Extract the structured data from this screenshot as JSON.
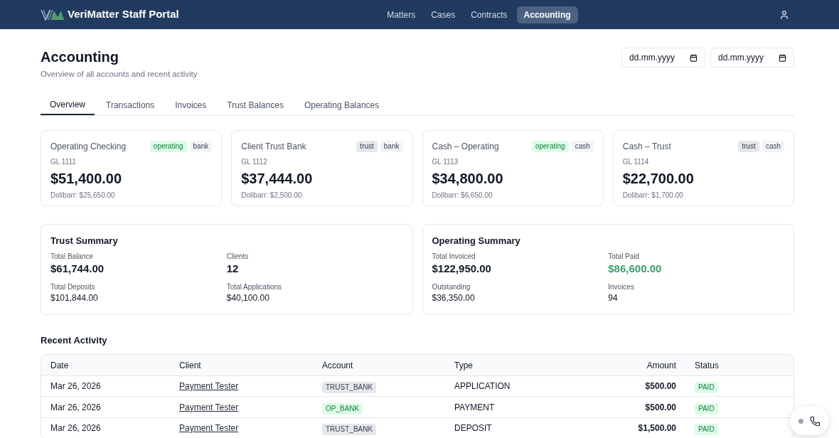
{
  "header": {
    "brand": "VeriMatter Staff Portal",
    "nav": [
      {
        "label": "Matters",
        "selected": false
      },
      {
        "label": "Cases",
        "selected": false
      },
      {
        "label": "Contracts",
        "selected": false
      },
      {
        "label": "Accounting",
        "selected": true
      }
    ]
  },
  "page": {
    "title": "Accounting",
    "subtitle": "Overview of all accounts and recent activity",
    "date_filters": [
      {
        "placeholder": "dd.mm.yyyy"
      },
      {
        "placeholder": "dd.mm.yyyy"
      }
    ]
  },
  "tabs": [
    {
      "label": "Overview",
      "selected": true
    },
    {
      "label": "Transactions",
      "selected": false
    },
    {
      "label": "Invoices",
      "selected": false
    },
    {
      "label": "Trust Balances",
      "selected": false
    },
    {
      "label": "Operating Balances",
      "selected": false
    }
  ],
  "accounts": [
    {
      "name": "Operating Checking",
      "tags": [
        {
          "label": "operating",
          "color": "#dcfce7"
        },
        {
          "label": "bank",
          "color": "#f3f4f6"
        }
      ],
      "gl": "GL 1111",
      "balance": "$51,400.00",
      "dolibarr": "Dolibarr: $25,650.00"
    },
    {
      "name": "Client Trust Bank",
      "tags": [
        {
          "label": "trust",
          "color": "#e5e7eb"
        },
        {
          "label": "bank",
          "color": "#f3f4f6"
        }
      ],
      "gl": "GL 1112",
      "balance": "$37,444.00",
      "dolibarr": "Dolibarr: $2,500.00"
    },
    {
      "name": "Cash – Operating",
      "tags": [
        {
          "label": "operating",
          "color": "#dcfce7"
        },
        {
          "label": "cash",
          "color": "#f3f4f6"
        }
      ],
      "gl": "GL 1113",
      "balance": "$34,800.00",
      "dolibarr": "Dolibarr: $6,650.00"
    },
    {
      "name": "Cash – Trust",
      "tags": [
        {
          "label": "trust",
          "color": "#e5e7eb"
        },
        {
          "label": "cash",
          "color": "#f3f4f6"
        }
      ],
      "gl": "GL 1114",
      "balance": "$22,700.00",
      "dolibarr": "Dolibarr: $1,700.00"
    }
  ],
  "summaries": [
    {
      "title": "Trust Summary",
      "stats": [
        {
          "label": "Total Balance",
          "value": "$61,744.00",
          "kind": "primary"
        },
        {
          "label": "Clients",
          "value": "12",
          "kind": "primary"
        },
        {
          "label": "Total Deposits",
          "value": "$101,844.00",
          "kind": "secondary"
        },
        {
          "label": "Total Applications",
          "value": "$40,100.00",
          "kind": "secondary"
        }
      ]
    },
    {
      "title": "Operating Summary",
      "stats": [
        {
          "label": "Total Invoiced",
          "value": "$122,950.00",
          "kind": "primary"
        },
        {
          "label": "Total Paid",
          "value": "$86,600.00",
          "kind": "primary",
          "color": "#38a169"
        },
        {
          "label": "Outstanding",
          "value": "$36,350.00",
          "kind": "secondary"
        },
        {
          "label": "Invoices",
          "value": "94",
          "kind": "secondary"
        }
      ]
    }
  ],
  "recent_activity": {
    "title": "Recent Activity",
    "columns": [
      "Date",
      "Client",
      "Account",
      "Type",
      "Amount",
      "Status"
    ],
    "rows": [
      {
        "date": "Mar 26, 2026",
        "client": "Payment Tester",
        "account": {
          "label": "TRUST_BANK",
          "color": "#e5e7eb"
        },
        "type": "APPLICATION",
        "amount": "$500.00",
        "status": {
          "label": "PAID",
          "color": "#dcfce7"
        }
      },
      {
        "date": "Mar 26, 2026",
        "client": "Payment Tester",
        "account": {
          "label": "OP_BANK",
          "color": "#dcfce7"
        },
        "type": "PAYMENT",
        "amount": "$500.00",
        "status": {
          "label": "PAID",
          "color": "#dcfce7"
        }
      },
      {
        "date": "Mar 26, 2026",
        "client": "Payment Tester",
        "account": {
          "label": "TRUST_BANK",
          "color": "#e5e7eb"
        },
        "type": "DEPOSIT",
        "amount": "$1,500.00",
        "status": {
          "label": "PAID",
          "color": "#dcfce7"
        }
      }
    ]
  }
}
